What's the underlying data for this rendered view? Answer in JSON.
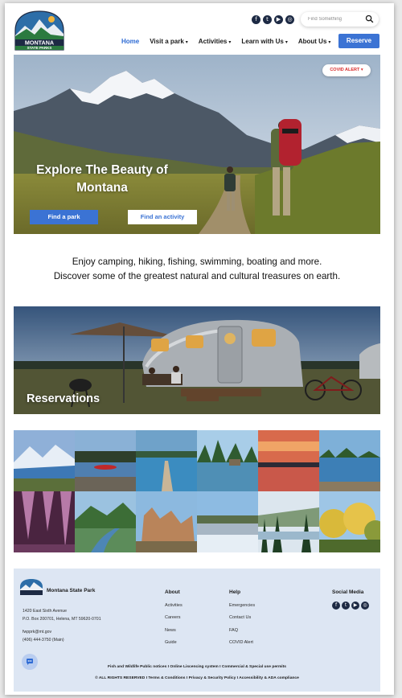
{
  "brand": {
    "logo_line1": "MONTANA",
    "logo_line2": "STATE PARKS"
  },
  "header": {
    "social_icons": [
      "facebook-icon",
      "twitter-icon",
      "youtube-icon",
      "instagram-icon"
    ],
    "search": {
      "placeholder": "Find Something"
    },
    "nav": [
      {
        "label": "Home",
        "active": true,
        "has_dropdown": false
      },
      {
        "label": "Visit a park",
        "active": false,
        "has_dropdown": true
      },
      {
        "label": "Activities",
        "active": false,
        "has_dropdown": true
      },
      {
        "label": "Learn with Us",
        "active": false,
        "has_dropdown": true
      },
      {
        "label": "About Us",
        "active": false,
        "has_dropdown": true
      }
    ],
    "reserve_label": "Reserve"
  },
  "hero": {
    "covid_label": "COVID ALERT",
    "title_line1": "Explore The Beauty of",
    "title_line2": "Montana",
    "btn_find_park": "Find a park",
    "btn_find_activity": "Find an activity"
  },
  "intro": {
    "line1": "Enjoy camping, hiking, fishing, swimming, boating and more.",
    "line2": "Discover some of the greatest natural and cultural treasures on earth."
  },
  "reservations": {
    "label": "Reservations"
  },
  "colors": {
    "accent": "#3b73d4",
    "alert": "#d82a2a",
    "footer_bg": "#dde6f3",
    "navy": "#1d2a44"
  },
  "footer": {
    "name": "Montana State Park",
    "address_line1": "1420 East Sixth Avenue",
    "address_line2": "P.O. Box 200701, Helena, MT 59620-0701",
    "email": "fwpprk@mt.gov",
    "phone": "(406) 444-3750  (Main)",
    "about": {
      "heading": "About",
      "links": [
        "Activities",
        "Careers",
        "News",
        "Guide"
      ]
    },
    "help": {
      "heading": "Help",
      "links": [
        "Emergencies",
        "Contact Us",
        "FAQ",
        "COVID Alert"
      ]
    },
    "social_heading": "Social Media",
    "notices_line": "Fish and Wildlife Public notices   I   Online Liscencing system   I   Commercial & Special use permits",
    "legal_line": "© ALL RIGHTS RESERVED   I   Terms & Conditions   I   Privacy & Security Policy   I   Accessibility & ADA compliance"
  }
}
